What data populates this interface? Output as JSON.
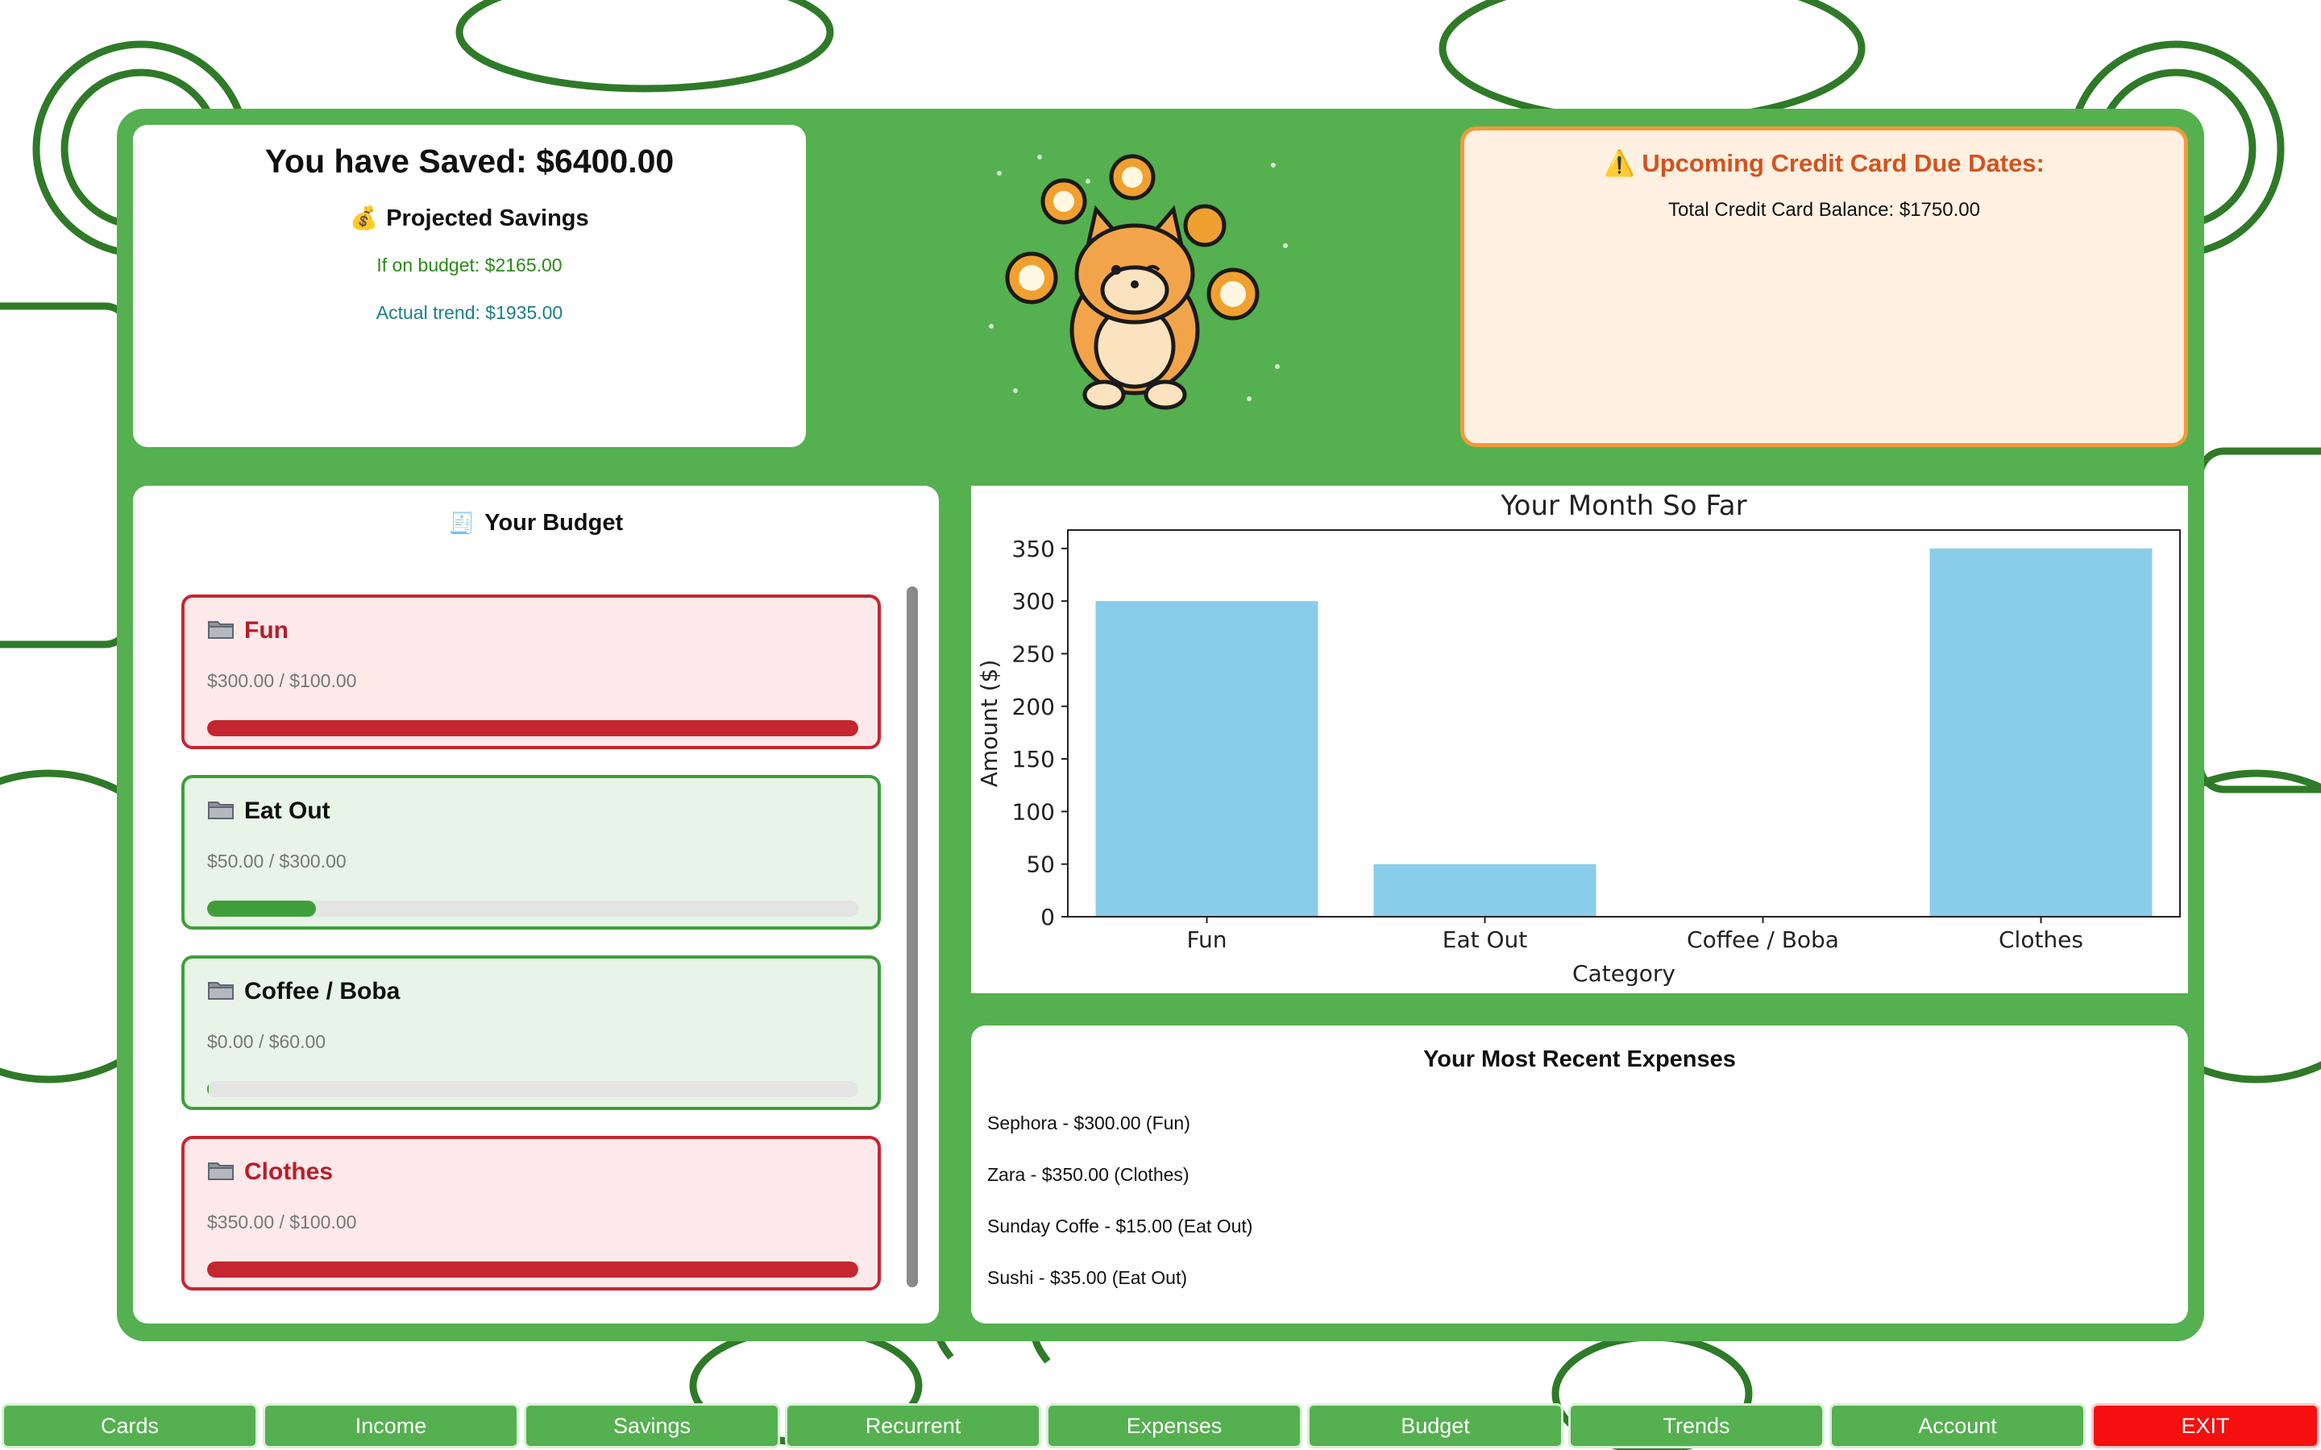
{
  "colors": {
    "brand_green": "#55b050",
    "over_budget_red": "#c5262f",
    "on_budget_green": "#3e9f3a",
    "warning_orange": "#d2531f",
    "bar_blue": "#89cdeb",
    "exit_red": "#f50f0f"
  },
  "savings": {
    "title": "You have Saved: $6400.00",
    "projected_icon": "money-bag-icon",
    "projected_title": "Projected Savings",
    "on_budget": "If on budget: $2165.00",
    "actual_trend": "Actual trend: $1935.00"
  },
  "mascot": {
    "icon": "shiba-juggling-coins-icon"
  },
  "credit_cards": {
    "icon": "warning-icon",
    "title": "Upcoming Credit Card Due Dates:",
    "total": "Total Credit Card Balance: $1750.00"
  },
  "budget": {
    "icon": "receipt-icon",
    "title": "Your Budget",
    "items": [
      {
        "name": "Fun",
        "amount": "$300.00 / $100.00",
        "status": "over",
        "progress": 1.0,
        "icon": "folder-icon"
      },
      {
        "name": "Eat Out",
        "amount": "$50.00 / $300.00",
        "status": "ok",
        "progress": 0.1667,
        "icon": "folder-icon"
      },
      {
        "name": "Coffee / Boba",
        "amount": "$0.00 / $60.00",
        "status": "ok",
        "progress": 0.0,
        "icon": "folder-icon"
      },
      {
        "name": "Clothes",
        "amount": "$350.00 / $100.00",
        "status": "over",
        "progress": 1.0,
        "icon": "folder-icon"
      }
    ]
  },
  "chart_data": {
    "type": "bar",
    "title": "Your Month So Far",
    "xlabel": "Category",
    "ylabel": "Amount ($)",
    "categories": [
      "Fun",
      "Eat Out",
      "Coffee / Boba",
      "Clothes"
    ],
    "values": [
      300,
      50,
      0,
      350
    ],
    "yticks": [
      0,
      50,
      100,
      150,
      200,
      250,
      300,
      350
    ],
    "ylim": [
      0,
      367.5
    ],
    "grid": false,
    "color": "#89cdeb"
  },
  "recent": {
    "title": "Your Most Recent Expenses",
    "items": [
      "Sephora - $300.00 (Fun)",
      "Zara - $350.00 (Clothes)",
      "Sunday Coffe - $15.00 (Eat Out)",
      "Sushi - $35.00 (Eat Out)"
    ]
  },
  "nav": {
    "buttons": [
      "Cards",
      "Income",
      "Savings",
      "Recurrent",
      "Expenses",
      "Budget",
      "Trends",
      "Account",
      "EXIT"
    ]
  }
}
